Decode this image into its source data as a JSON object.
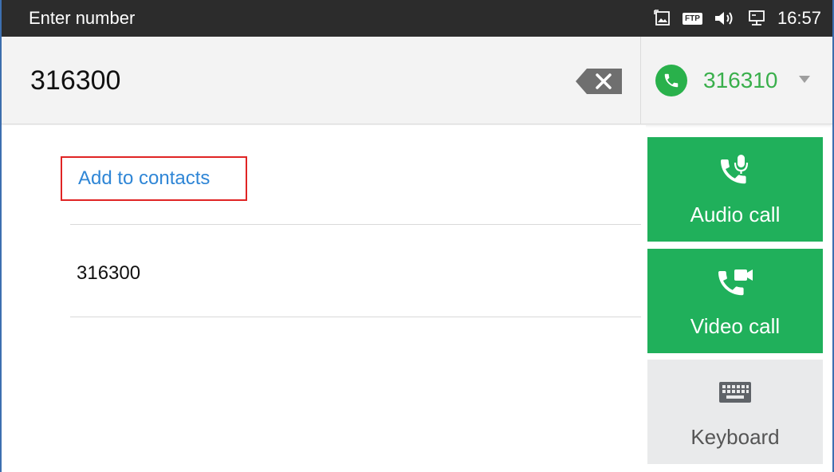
{
  "statusbar": {
    "title": "Enter number",
    "ftp_label": "FTP",
    "time": "16:57",
    "icons": [
      "screenshot-icon",
      "ftp-icon",
      "volume-icon",
      "network-icon"
    ]
  },
  "dialer": {
    "number": "316300",
    "account": {
      "number": "316310",
      "icon": "phone-icon",
      "color": "#3aaf4c"
    }
  },
  "suggestions": {
    "add_to_contacts": "Add to contacts",
    "items": [
      {
        "number": "316300"
      }
    ]
  },
  "actions": {
    "audio_call": "Audio call",
    "video_call": "Video call",
    "keyboard": "Keyboard"
  },
  "colors": {
    "accent_green": "#20b05b",
    "link_blue": "#2f86d6",
    "highlight_red": "#e02424",
    "statusbar_bg": "#2c2c2c"
  }
}
